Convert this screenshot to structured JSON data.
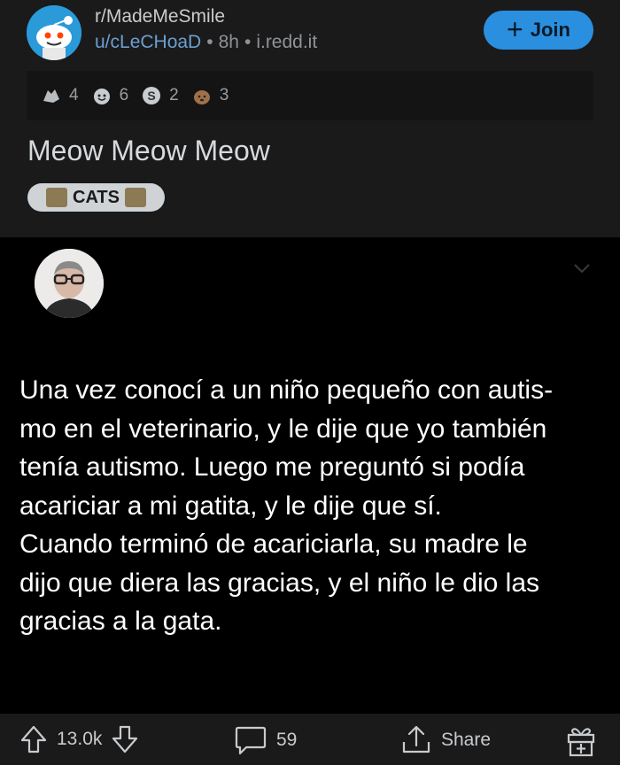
{
  "post": {
    "subreddit": "r/MadeMeSmile",
    "author": "u/cLeCHoaD",
    "age": "8h",
    "domain": "i.redd.it",
    "join_label": "Join",
    "awards": [
      {
        "icon": "award-hands-icon",
        "count": "4"
      },
      {
        "icon": "award-wholesome-icon",
        "count": "6"
      },
      {
        "icon": "award-silver-icon",
        "count": "2"
      },
      {
        "icon": "award-dog-icon",
        "count": "3"
      }
    ],
    "title": "Meow Meow Meow",
    "flair": "CATS"
  },
  "image": {
    "text_lines": [
      "Una vez conocí a un niño pequeño con autis-",
      "mo en el veterinario, y le dije que yo también",
      "tenía autismo. Luego me preguntó si podía",
      "acariciar a mi gatita, y le dije que sí.",
      "Cuando terminó de acariciarla, su madre le",
      "dijo que diera las gracias, y el niño le dio las",
      "gracias a la gata."
    ]
  },
  "footer": {
    "score": "13.0k",
    "comments": "59",
    "share_label": "Share"
  },
  "colors": {
    "background": "#000000",
    "header_bg": "#1a1a1b",
    "join_blue": "#2b8fe0",
    "author_link": "#6b9fd1"
  }
}
